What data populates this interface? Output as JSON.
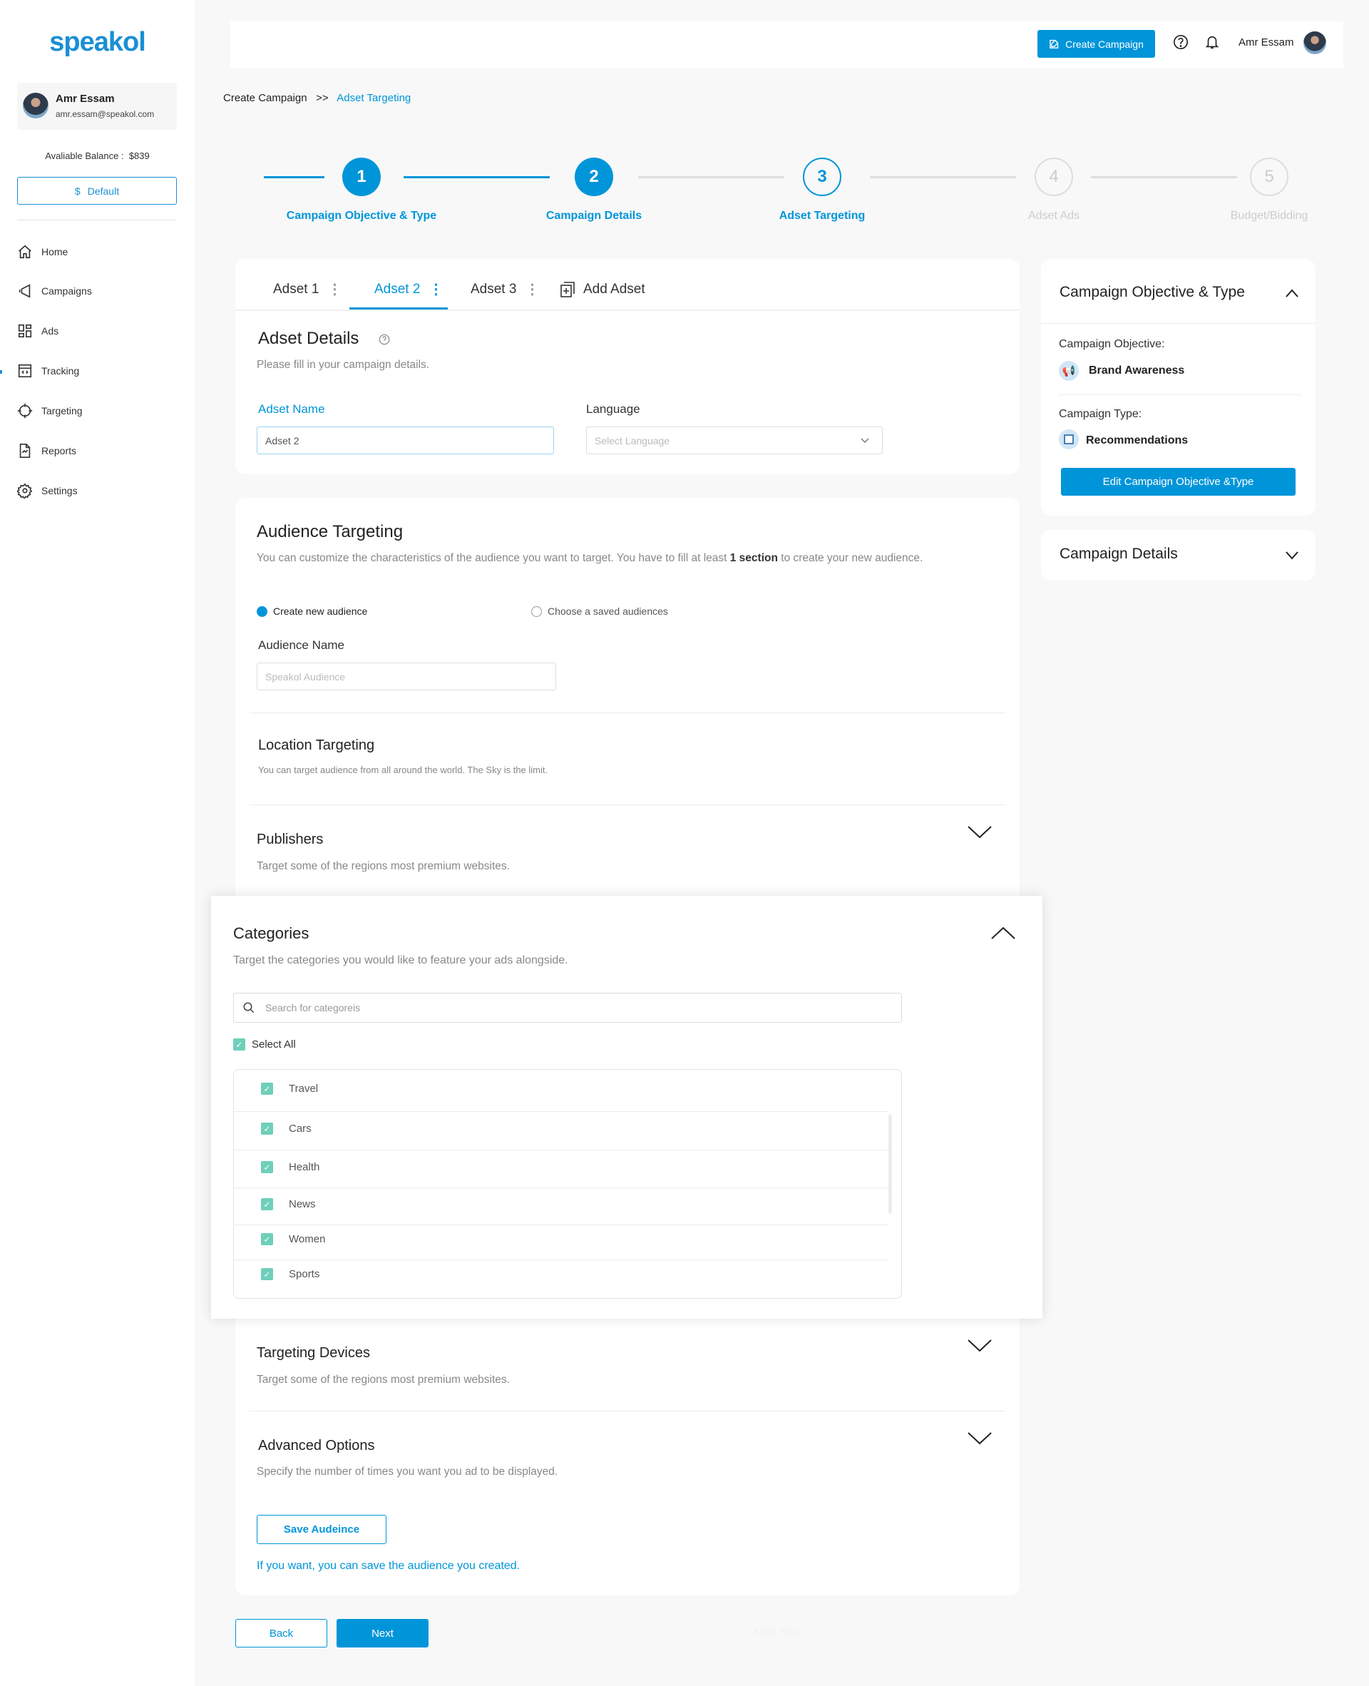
{
  "brand": {
    "logo": "speakol",
    "accent": "#0095d9",
    "check_color": "#6fcfbb"
  },
  "sidebar": {
    "user_name": "Amr Essam",
    "user_email": "amr.essam@speakol.com",
    "balance_label": "Avaliable Balance :",
    "balance_value": "$839",
    "account_button": "Default",
    "account_icon": "$",
    "items": [
      {
        "label": "Home",
        "icon": "home-icon"
      },
      {
        "label": "Campaigns",
        "icon": "megaphone-icon"
      },
      {
        "label": "Ads",
        "icon": "grid-icon"
      },
      {
        "label": "Tracking",
        "icon": "code-window-icon"
      },
      {
        "label": "Targeting",
        "icon": "crosshair-icon"
      },
      {
        "label": "Reports",
        "icon": "report-icon"
      },
      {
        "label": "Settings",
        "icon": "gear-icon"
      }
    ]
  },
  "topbar": {
    "create_campaign": "Create Campaign",
    "user_name": "Amr Essam"
  },
  "breadcrumb": {
    "parent": "Create Campaign",
    "separator": ">>",
    "current": "Adset Targeting"
  },
  "stepper": [
    {
      "num": "1",
      "label": "Campaign Objective & Type",
      "state": "done"
    },
    {
      "num": "2",
      "label": "Campaign Details",
      "state": "done"
    },
    {
      "num": "3",
      "label": "Adset Targeting",
      "state": "current"
    },
    {
      "num": "4",
      "label": "Adset Ads",
      "state": "todo"
    },
    {
      "num": "5",
      "label": "Budget/Bidding",
      "state": "todo"
    }
  ],
  "tabs": {
    "items": [
      "Adset 1",
      "Adset 2",
      "Adset 3"
    ],
    "active": "Adset 2",
    "add": "Add Adset"
  },
  "adset_details": {
    "title": "Adset Details",
    "subtitle": "Please fill in your campaign details.",
    "name_label": "Adset Name",
    "name_value": "Adset 2",
    "language_label": "Language",
    "language_placeholder": "Select Language"
  },
  "audience": {
    "title": "Audience Targeting",
    "desc_pre": "You can customize the characteristics of the audience you want to target. You have to fill at least ",
    "desc_bold": "1 section",
    "desc_post": " to create your new audience.",
    "radio_new": "Create new audience",
    "radio_saved": "Choose a saved audiences",
    "selected": "new",
    "name_label": "Audience Name",
    "name_placeholder": "Speakol Audience"
  },
  "location": {
    "title": "Location Targeting",
    "desc": "You can  target audience from all around the world. The Sky is the limit."
  },
  "publishers": {
    "title": "Publishers",
    "desc": "Target some of the regions most premium websites."
  },
  "categories": {
    "title": "Categories",
    "desc": "Target the categories you would like to feature your ads alongside.",
    "search_placeholder": "Search for categoreis",
    "select_all": "Select All",
    "items": [
      {
        "label": "Travel",
        "checked": true
      },
      {
        "label": "Cars",
        "checked": true
      },
      {
        "label": "Health",
        "checked": true
      },
      {
        "label": "News",
        "checked": true
      },
      {
        "label": "Women",
        "checked": true
      },
      {
        "label": "Sports",
        "checked": true
      }
    ]
  },
  "devices": {
    "title": "Targeting Devices",
    "desc": "Target some of the regions most premium websites."
  },
  "advanced": {
    "title": "Advanced Options",
    "desc": "Specify the number of times you want you ad to be displayed."
  },
  "save_audience": {
    "button": "Save Audeince",
    "hint": "If you want, you can save the audience you created."
  },
  "footer": {
    "back": "Back",
    "next": "Next",
    "next_step": "Next Step"
  },
  "summary": {
    "objective_card_title": "Campaign Objective & Type",
    "objective_label": "Campaign Objective:",
    "objective_value": "Brand Awareness",
    "type_label": "Campaign Type:",
    "type_value": "Recommendations",
    "edit_button": "Edit Campaign Objective &Type",
    "details_card_title": "Campaign Details"
  }
}
